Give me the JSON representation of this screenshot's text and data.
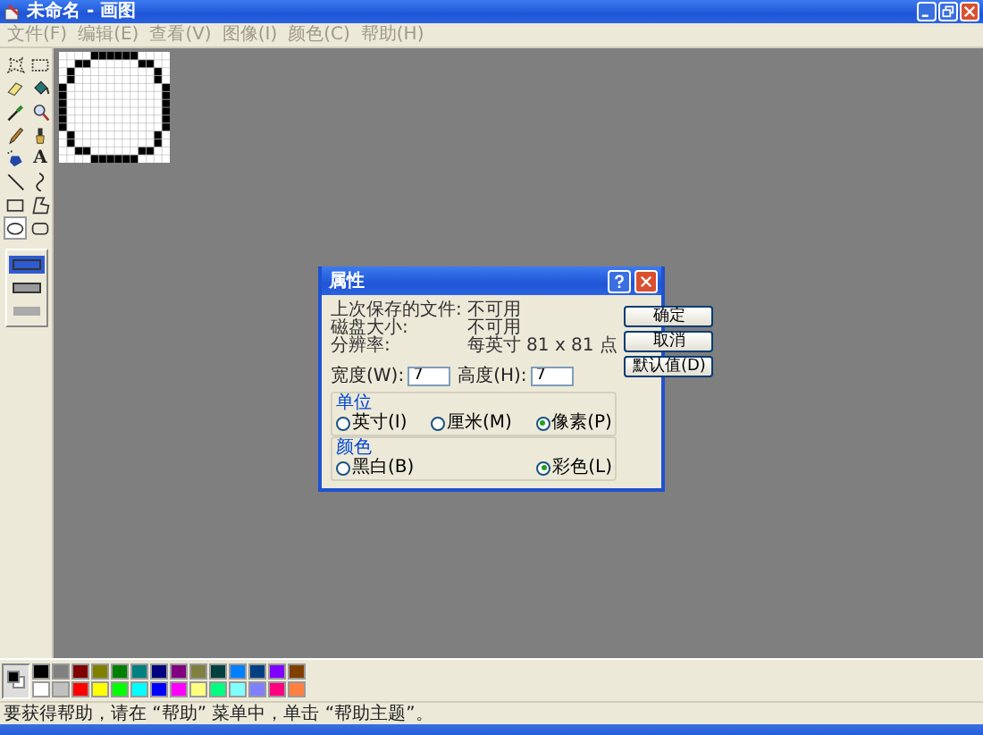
{
  "window": {
    "title": "未命名 - 画图"
  },
  "menu": [
    "文件(F)",
    "编辑(E)",
    "查看(V)",
    "图像(I)",
    "颜色(C)",
    "帮助(H)"
  ],
  "tools": [
    {
      "kind": "free-select",
      "selected": false
    },
    {
      "kind": "rect-select",
      "selected": false
    },
    {
      "kind": "eraser",
      "selected": false
    },
    {
      "kind": "fill",
      "selected": false
    },
    {
      "kind": "picker",
      "selected": false
    },
    {
      "kind": "magnifier",
      "selected": false
    },
    {
      "kind": "pencil",
      "selected": false
    },
    {
      "kind": "brush",
      "selected": false
    },
    {
      "kind": "airbrush",
      "selected": false
    },
    {
      "kind": "text",
      "label": "A",
      "selected": false
    },
    {
      "kind": "line",
      "selected": false
    },
    {
      "kind": "curve",
      "selected": false
    },
    {
      "kind": "rectangle",
      "selected": false
    },
    {
      "kind": "polygon",
      "selected": false
    },
    {
      "kind": "ellipse",
      "selected": true
    },
    {
      "kind": "rounded-rectangle",
      "selected": false
    }
  ],
  "fill_styles": [
    {
      "selected": true
    },
    {
      "selected": false
    },
    {
      "selected": false
    }
  ],
  "dialog": {
    "title": "属性",
    "info": [
      {
        "label": "上次保存的文件:",
        "value": "不可用"
      },
      {
        "label": "磁盘大小:",
        "value": "不可用"
      },
      {
        "label": "分辨率:",
        "value": "每英寸 81 x 81 点"
      }
    ],
    "width": {
      "label": "宽度(W):",
      "value": "7"
    },
    "height": {
      "label": "高度(H):",
      "value": "7"
    },
    "groups": [
      {
        "title": "单位",
        "options": [
          {
            "label": "英寸(I)",
            "selected": false
          },
          {
            "label": "厘米(M)",
            "selected": false
          },
          {
            "label": "像素(P)",
            "selected": true
          }
        ]
      },
      {
        "title": "颜色",
        "options": [
          {
            "label": "黑白(B)",
            "selected": false
          },
          {
            "label": "彩色(L)",
            "selected": true
          }
        ]
      }
    ],
    "buttons": [
      "确定",
      "取消",
      "默认值(D)"
    ]
  },
  "current_colors": [
    {
      "color": "#000000"
    },
    {
      "color": "#ffffff"
    }
  ],
  "palette": [
    {
      "color": "#000000"
    },
    {
      "color": "#808080"
    },
    {
      "color": "#800000"
    },
    {
      "color": "#808000"
    },
    {
      "color": "#008000"
    },
    {
      "color": "#008080"
    },
    {
      "color": "#000080"
    },
    {
      "color": "#800080"
    },
    {
      "color": "#808040"
    },
    {
      "color": "#004040"
    },
    {
      "color": "#0080ff"
    },
    {
      "color": "#004080"
    },
    {
      "color": "#8000ff"
    },
    {
      "color": "#804000"
    },
    {
      "color": "#ffffff"
    },
    {
      "color": "#c0c0c0"
    },
    {
      "color": "#ff0000"
    },
    {
      "color": "#ffff00"
    },
    {
      "color": "#00ff00"
    },
    {
      "color": "#00ffff"
    },
    {
      "color": "#0000ff"
    },
    {
      "color": "#ff00ff"
    },
    {
      "color": "#ffff80"
    },
    {
      "color": "#00ff80"
    },
    {
      "color": "#80ffff"
    },
    {
      "color": "#8080ff"
    },
    {
      "color": "#ff0080"
    },
    {
      "color": "#ff8040"
    }
  ],
  "status_bar": "要获得帮助，请在 “帮助” 菜单中，单击 “帮助主题”。"
}
